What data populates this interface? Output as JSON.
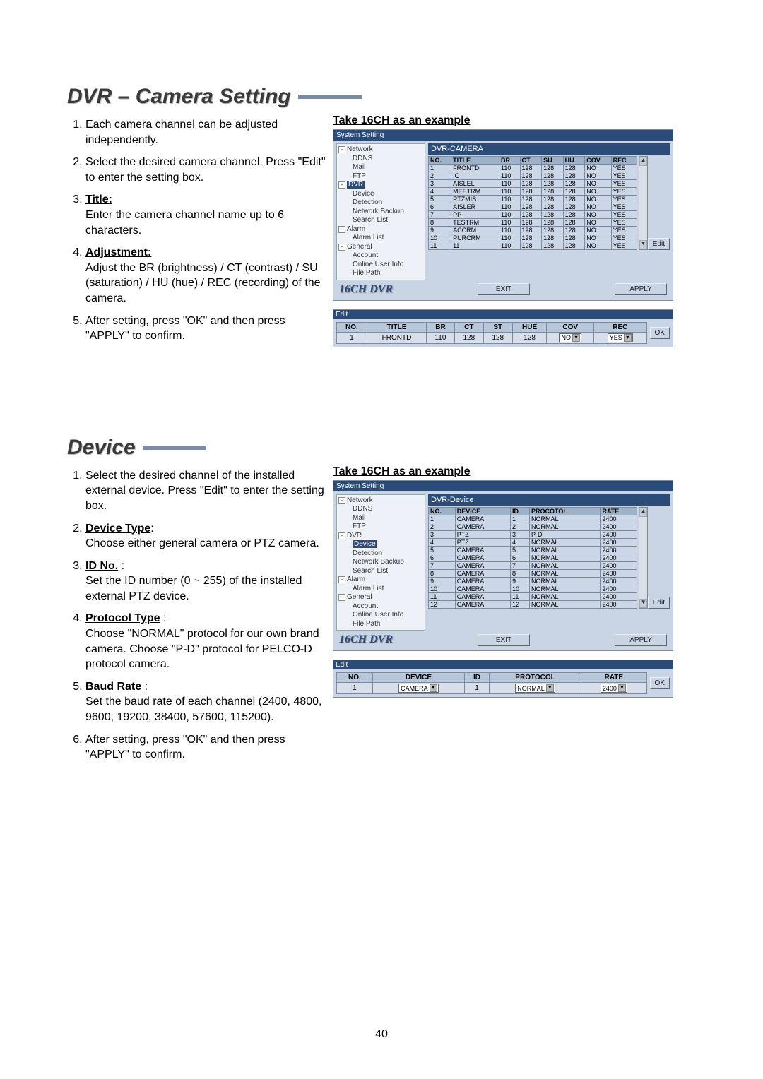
{
  "pageNumber": "40",
  "sec1": {
    "title": "DVR – Camera Setting",
    "subtitle": "Take 16CH as an example",
    "items": {
      "i1": "Each camera channel can be adjusted independently.",
      "i2": "Select the desired camera channel. Press \"Edit\" to enter the setting box.",
      "i3label": "Title:",
      "i3body": "Enter the camera channel name up to 6 characters.",
      "i4label": "Adjustment:",
      "i4body": "Adjust the BR (brightness) / CT (contrast) / SU (saturation) / HU (hue) / REC (recording) of the camera.",
      "i5": "After setting, press \"OK\" and then press \"APPLY\" to confirm."
    },
    "window": {
      "title": "System Setting",
      "paneTitle": "DVR-CAMERA",
      "brand": "16CH DVR",
      "btnExit": "EXIT",
      "btnApply": "APPLY",
      "btnEdit": "Edit",
      "tree": {
        "network": "Network",
        "ddns": "DDNS",
        "mail": "Mail",
        "ftp": "FTP",
        "dvr": "DVR",
        "device": "Device",
        "detection": "Detection",
        "nbackup": "Network Backup",
        "searchlist": "Search List",
        "alarm": "Alarm",
        "alarmlist": "Alarm List",
        "general": "General",
        "account": "Account",
        "online": "Online User Info",
        "filepath": "File Path"
      },
      "cols": {
        "no": "NO.",
        "title": "TITLE",
        "br": "BR",
        "ct": "CT",
        "su": "SU",
        "hu": "HU",
        "cov": "COV",
        "rec": "REC"
      },
      "chart_data": {
        "type": "table",
        "headers": [
          "NO.",
          "TITLE",
          "BR",
          "CT",
          "SU",
          "HU",
          "COV",
          "REC"
        ],
        "rows": [
          {
            "no": "1",
            "title": "FRONTD",
            "br": "110",
            "ct": "128",
            "su": "128",
            "hu": "128",
            "cov": "NO",
            "rec": "YES"
          },
          {
            "no": "2",
            "title": "IC",
            "br": "110",
            "ct": "128",
            "su": "128",
            "hu": "128",
            "cov": "NO",
            "rec": "YES"
          },
          {
            "no": "3",
            "title": "AISLEL",
            "br": "110",
            "ct": "128",
            "su": "128",
            "hu": "128",
            "cov": "NO",
            "rec": "YES"
          },
          {
            "no": "4",
            "title": "MEETRM",
            "br": "110",
            "ct": "128",
            "su": "128",
            "hu": "128",
            "cov": "NO",
            "rec": "YES"
          },
          {
            "no": "5",
            "title": "PTZMIS",
            "br": "110",
            "ct": "128",
            "su": "128",
            "hu": "128",
            "cov": "NO",
            "rec": "YES"
          },
          {
            "no": "6",
            "title": "AISLER",
            "br": "110",
            "ct": "128",
            "su": "128",
            "hu": "128",
            "cov": "NO",
            "rec": "YES"
          },
          {
            "no": "7",
            "title": "PP",
            "br": "110",
            "ct": "128",
            "su": "128",
            "hu": "128",
            "cov": "NO",
            "rec": "YES"
          },
          {
            "no": "8",
            "title": "TESTRM",
            "br": "110",
            "ct": "128",
            "su": "128",
            "hu": "128",
            "cov": "NO",
            "rec": "YES"
          },
          {
            "no": "9",
            "title": "ACCRM",
            "br": "110",
            "ct": "128",
            "su": "128",
            "hu": "128",
            "cov": "NO",
            "rec": "YES"
          },
          {
            "no": "10",
            "title": "PURCRM",
            "br": "110",
            "ct": "128",
            "su": "128",
            "hu": "128",
            "cov": "NO",
            "rec": "YES"
          },
          {
            "no": "11",
            "title": "11",
            "br": "110",
            "ct": "128",
            "su": "128",
            "hu": "128",
            "cov": "NO",
            "rec": "YES"
          }
        ]
      }
    },
    "edit": {
      "title": "Edit",
      "cols": {
        "no": "NO.",
        "title": "TITLE",
        "br": "BR",
        "ct": "CT",
        "st": "ST",
        "hue": "HUE",
        "cov": "COV",
        "rec": "REC"
      },
      "row": {
        "no": "1",
        "title": "FRONTD",
        "br": "110",
        "ct": "128",
        "st": "128",
        "hue": "128",
        "cov": "NO",
        "rec": "YES"
      },
      "btnOk": "OK"
    }
  },
  "sec2": {
    "title": "Device",
    "subtitle": "Take 16CH as an example",
    "items": {
      "i1": "Select the desired channel of the installed external device. Press \"Edit\" to enter the setting box.",
      "i2label": "Device Type",
      "i2body": "Choose either general camera or PTZ camera.",
      "i3label": "ID No.",
      "i3body": "Set the ID number (0 ~ 255) of the installed external PTZ device.",
      "i4label": "Protocol Type",
      "i4body": "Choose \"NORMAL\" protocol for our own brand camera. Choose \"P-D\" protocol for PELCO-D protocol camera.",
      "i5label": "Baud Rate",
      "i5body": "Set the baud rate of each channel (2400, 4800, 9600, 19200, 38400, 57600, 115200).",
      "i6": "After setting, press \"OK\" and then press \"APPLY\" to confirm."
    },
    "window": {
      "title": "System Setting",
      "paneTitle": "DVR-Device",
      "brand": "16CH DVR",
      "btnExit": "EXIT",
      "btnApply": "APPLY",
      "btnEdit": "Edit",
      "tree": {
        "network": "Network",
        "ddns": "DDNS",
        "mail": "Mail",
        "ftp": "FTP",
        "dvr": "DVR",
        "device": "Device",
        "detection": "Detection",
        "nbackup": "Network Backup",
        "searchlist": "Search List",
        "alarm": "Alarm",
        "alarmlist": "Alarm List",
        "general": "General",
        "account": "Account",
        "online": "Online User Info",
        "filepath": "File Path"
      },
      "cols": {
        "no": "NO.",
        "device": "DEVICE",
        "id": "ID",
        "proto": "PROCOTOL",
        "rate": "RATE"
      },
      "chart_data": {
        "type": "table",
        "headers": [
          "NO.",
          "DEVICE",
          "ID",
          "PROCOTOL",
          "RATE"
        ],
        "rows": [
          {
            "no": "1",
            "dev": "CAMERA",
            "id": "1",
            "proto": "NORMAL",
            "rate": "2400"
          },
          {
            "no": "2",
            "dev": "CAMERA",
            "id": "2",
            "proto": "NORMAL",
            "rate": "2400"
          },
          {
            "no": "3",
            "dev": "PTZ",
            "id": "3",
            "proto": "P-D",
            "rate": "2400"
          },
          {
            "no": "4",
            "dev": "PTZ",
            "id": "4",
            "proto": "NORMAL",
            "rate": "2400"
          },
          {
            "no": "5",
            "dev": "CAMERA",
            "id": "5",
            "proto": "NORMAL",
            "rate": "2400"
          },
          {
            "no": "6",
            "dev": "CAMERA",
            "id": "6",
            "proto": "NORMAL",
            "rate": "2400"
          },
          {
            "no": "7",
            "dev": "CAMERA",
            "id": "7",
            "proto": "NORMAL",
            "rate": "2400"
          },
          {
            "no": "8",
            "dev": "CAMERA",
            "id": "8",
            "proto": "NORMAL",
            "rate": "2400"
          },
          {
            "no": "9",
            "dev": "CAMERA",
            "id": "9",
            "proto": "NORMAL",
            "rate": "2400"
          },
          {
            "no": "10",
            "dev": "CAMERA",
            "id": "10",
            "proto": "NORMAL",
            "rate": "2400"
          },
          {
            "no": "11",
            "dev": "CAMERA",
            "id": "11",
            "proto": "NORMAL",
            "rate": "2400"
          },
          {
            "no": "12",
            "dev": "CAMERA",
            "id": "12",
            "proto": "NORMAL",
            "rate": "2400"
          }
        ]
      }
    },
    "edit": {
      "title": "Edit",
      "cols": {
        "no": "NO.",
        "device": "DEVICE",
        "id": "ID",
        "proto": "PROTOCOL",
        "rate": "RATE"
      },
      "row": {
        "no": "1",
        "device": "CAMERA",
        "id": "1",
        "proto": "NORMAL",
        "rate": "2400"
      },
      "btnOk": "OK"
    }
  }
}
